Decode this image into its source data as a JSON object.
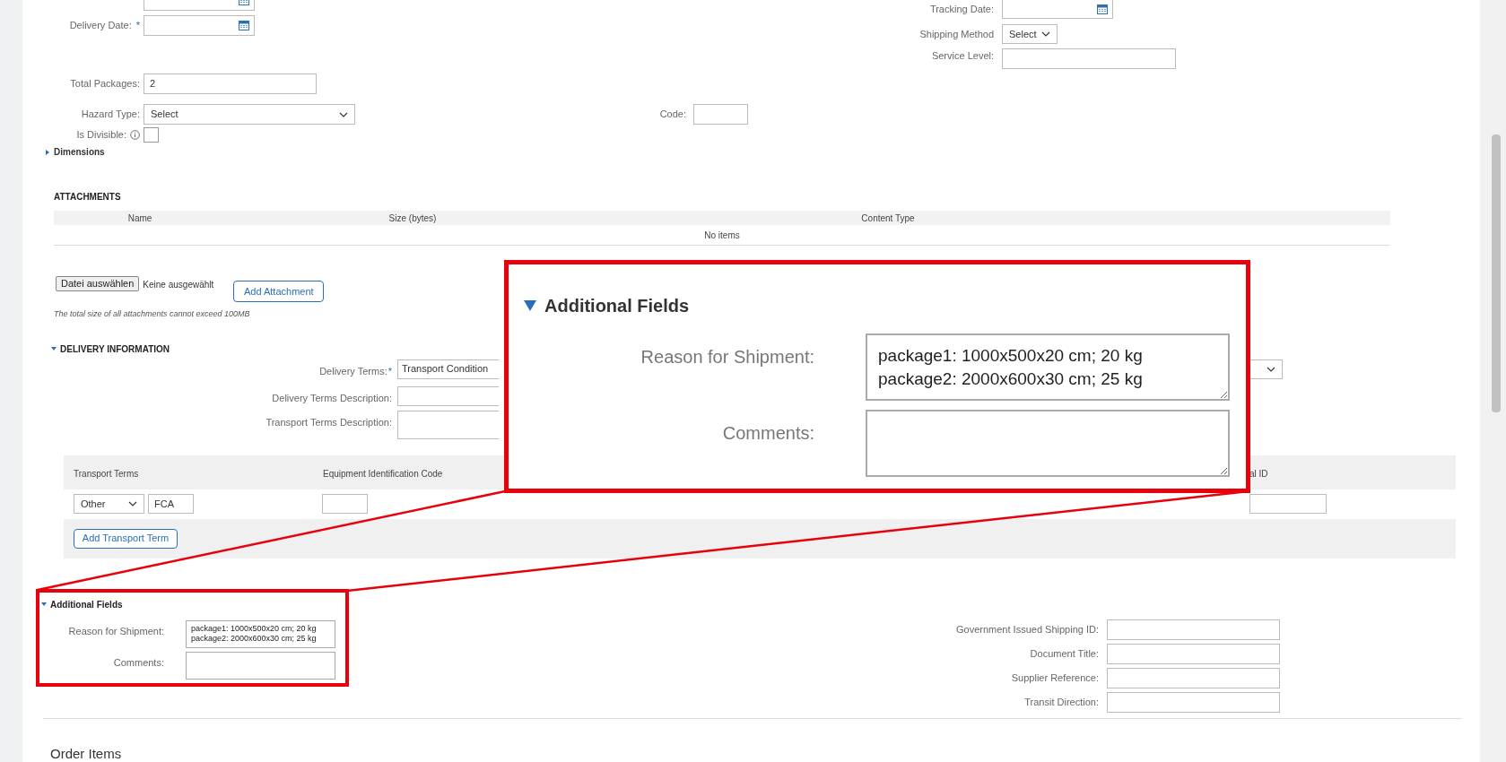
{
  "shipment_details": {
    "left_fields": [
      {
        "kind": "date"
      },
      {
        "kind": "date",
        "label": "Delivery Date:",
        "required_mark": "*"
      },
      {
        "kind": "text",
        "label": "Total Packages:",
        "value": "2"
      },
      {
        "kind": "select",
        "label": "Hazard Type:",
        "value": "Select"
      },
      {
        "kind": "checkbox",
        "label": "Is Divisible:",
        "info": true,
        "checked": false
      }
    ],
    "code_field": {
      "label": "Code:"
    },
    "right_fields": [
      {
        "kind": "date",
        "label": "Tracking Date:"
      },
      {
        "kind": "select",
        "label": "Shipping Method",
        "value": "Select"
      },
      {
        "kind": "text",
        "label": "Service Level:"
      }
    ],
    "dimensions": {
      "label": "Dimensions",
      "expanded": false
    }
  },
  "attachments": {
    "title": "ATTACHMENTS",
    "columns": [
      "Name",
      "Size (bytes)",
      "Content Type"
    ],
    "empty_text": "No items",
    "file_button": "Datei auswählen",
    "file_status": "Keine ausgewählt",
    "add_button": "Add Attachment",
    "note": "The total size of all attachments cannot exceed 100MB"
  },
  "delivery_information": {
    "title": "DELIVERY INFORMATION",
    "expanded": true,
    "fields": [
      {
        "kind": "select",
        "label": "Delivery Terms:",
        "required_mark": "*",
        "value": "Transport Condition"
      },
      {
        "kind": "text",
        "label": "Delivery Terms Description:"
      },
      {
        "kind": "textarea",
        "label": "Transport Terms Description:"
      }
    ],
    "transport_table": {
      "columns": [
        "Transport Terms",
        "Equipment Identification Code",
        "al ID"
      ],
      "rows": [
        {
          "term": "Other",
          "code": "FCA"
        }
      ],
      "add_button": "Add Transport Term"
    }
  },
  "additional_fields": {
    "title": "Additional Fields",
    "expanded": true,
    "left": [
      {
        "label": "Reason for Shipment:",
        "value": "package1: 1000x500x20 cm; 20 kg\npackage2: 2000x600x30 cm; 25 kg"
      },
      {
        "label": "Comments:"
      }
    ],
    "right": [
      {
        "label": "Government Issued Shipping ID:"
      },
      {
        "label": "Document Title:"
      },
      {
        "label": "Supplier Reference:"
      },
      {
        "label": "Transit Direction:"
      }
    ]
  },
  "order_items": {
    "title": "Order Items"
  },
  "callout": {
    "title": "Additional Fields",
    "expanded": true,
    "fields": [
      {
        "label": "Reason for Shipment:",
        "value": "package1: 1000x500x20 cm; 20 kg\npackage2: 2000x600x30 cm; 25 kg"
      },
      {
        "label": "Comments:"
      }
    ]
  }
}
